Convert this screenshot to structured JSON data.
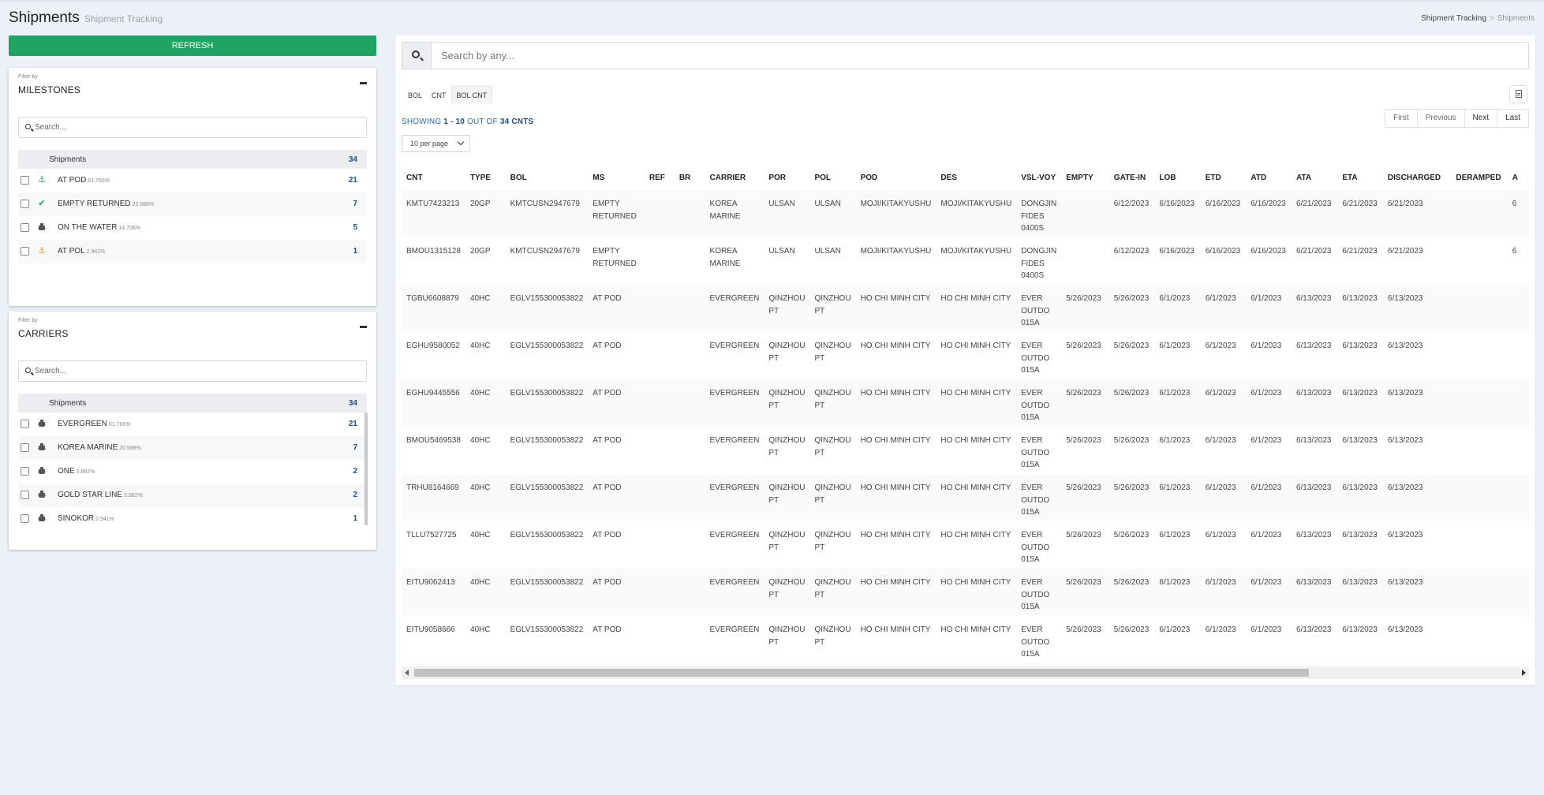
{
  "header": {
    "title": "Shipments",
    "subtitle": "Shipment Tracking"
  },
  "breadcrumb": {
    "parent": "Shipment Tracking",
    "separator": ">",
    "current": "Shipments"
  },
  "refresh_label": "REFRESH",
  "milestones": {
    "filter_by": "Filter by",
    "title": "MILESTONES",
    "search_placeholder": "Search...",
    "header_label": "Shipments",
    "header_count": "34",
    "items": [
      {
        "label": "AT POD",
        "pct": "61.765%",
        "count": "21",
        "icon": "anchor-icon"
      },
      {
        "label": "EMPTY RETURNED",
        "pct": "20.588%",
        "count": "7",
        "icon": "check-icon"
      },
      {
        "label": "ON THE WATER",
        "pct": "14.706%",
        "count": "5",
        "icon": "ship-icon"
      },
      {
        "label": "AT POL",
        "pct": "2.941%",
        "count": "1",
        "icon": "anchor-icon"
      }
    ]
  },
  "carriers": {
    "filter_by": "Filter by",
    "title": "CARRIERS",
    "search_placeholder": "Search...",
    "header_label": "Shipments",
    "header_count": "34",
    "items": [
      {
        "label": "EVERGREEN",
        "pct": "61.765%",
        "count": "21",
        "icon": "ship-icon"
      },
      {
        "label": "KOREA MARINE",
        "pct": "20.588%",
        "count": "7",
        "icon": "ship-icon"
      },
      {
        "label": "ONE",
        "pct": "5.882%",
        "count": "2",
        "icon": "ship-icon"
      },
      {
        "label": "GOLD STAR LINE",
        "pct": "5.882%",
        "count": "2",
        "icon": "ship-icon"
      },
      {
        "label": "SINOKOR",
        "pct": "2.941%",
        "count": "1",
        "icon": "ship-icon"
      }
    ]
  },
  "search": {
    "placeholder": "Search by any..."
  },
  "view_tabs": [
    "BOL",
    "CNT",
    "BOL CNT"
  ],
  "active_view_tab": "BOL CNT",
  "showing": {
    "prefix": "SHOWING",
    "range": "1 - 10",
    "mid": "OUT OF",
    "total": "34 CNTS"
  },
  "pagination": {
    "first": "First",
    "previous": "Previous",
    "next": "Next",
    "last": "Last"
  },
  "per_page": "10 per page",
  "table": {
    "columns": [
      "CNT",
      "TYPE",
      "BOL",
      "MS",
      "REF",
      "BR",
      "CARRIER",
      "POR",
      "POL",
      "POD",
      "DES",
      "VSL-VOY",
      "EMPTY",
      "GATE-IN",
      "LOB",
      "ETD",
      "ATD",
      "ATA",
      "ETA",
      "DISCHARGED",
      "DERAMPED",
      "A"
    ],
    "rows": [
      [
        "KMTU7423213",
        "20GP",
        "KMTCUSN2947679",
        "EMPTY RETURNED",
        "",
        "",
        "KOREA MARINE",
        "ULSAN",
        "ULSAN",
        "MOJI/KITAKYUSHU",
        "MOJI/KITAKYUSHU",
        "DONGJIN FIDES 0400S",
        "",
        "6/12/2023",
        "6/16/2023",
        "6/16/2023",
        "6/16/2023",
        "6/21/2023",
        "6/21/2023",
        "6/21/2023",
        "",
        "6"
      ],
      [
        "BMOU1315128",
        "20GP",
        "KMTCUSN2947679",
        "EMPTY RETURNED",
        "",
        "",
        "KOREA MARINE",
        "ULSAN",
        "ULSAN",
        "MOJI/KITAKYUSHU",
        "MOJI/KITAKYUSHU",
        "DONGJIN FIDES 0400S",
        "",
        "6/12/2023",
        "6/16/2023",
        "6/16/2023",
        "6/16/2023",
        "6/21/2023",
        "6/21/2023",
        "6/21/2023",
        "",
        "6"
      ],
      [
        "TGBU6608879",
        "40HC",
        "EGLV155300053822",
        "AT POD",
        "",
        "",
        "EVERGREEN",
        "QINZHOU PT",
        "QINZHOU PT",
        "HO CHI MINH CITY",
        "HO CHI MINH CITY",
        "EVER OUTDO 015A",
        "5/26/2023",
        "5/26/2023",
        "6/1/2023",
        "6/1/2023",
        "6/1/2023",
        "6/13/2023",
        "6/13/2023",
        "6/13/2023",
        "",
        ""
      ],
      [
        "EGHU9580052",
        "40HC",
        "EGLV155300053822",
        "AT POD",
        "",
        "",
        "EVERGREEN",
        "QINZHOU PT",
        "QINZHOU PT",
        "HO CHI MINH CITY",
        "HO CHI MINH CITY",
        "EVER OUTDO 015A",
        "5/26/2023",
        "5/26/2023",
        "6/1/2023",
        "6/1/2023",
        "6/1/2023",
        "6/13/2023",
        "6/13/2023",
        "6/13/2023",
        "",
        ""
      ],
      [
        "EGHU9445556",
        "40HC",
        "EGLV155300053822",
        "AT POD",
        "",
        "",
        "EVERGREEN",
        "QINZHOU PT",
        "QINZHOU PT",
        "HO CHI MINH CITY",
        "HO CHI MINH CITY",
        "EVER OUTDO 015A",
        "5/26/2023",
        "5/26/2023",
        "6/1/2023",
        "6/1/2023",
        "6/1/2023",
        "6/13/2023",
        "6/13/2023",
        "6/13/2023",
        "",
        ""
      ],
      [
        "BMOU5469538",
        "40HC",
        "EGLV155300053822",
        "AT POD",
        "",
        "",
        "EVERGREEN",
        "QINZHOU PT",
        "QINZHOU PT",
        "HO CHI MINH CITY",
        "HO CHI MINH CITY",
        "EVER OUTDO 015A",
        "5/26/2023",
        "5/26/2023",
        "6/1/2023",
        "6/1/2023",
        "6/1/2023",
        "6/13/2023",
        "6/13/2023",
        "6/13/2023",
        "",
        ""
      ],
      [
        "TRHU8164669",
        "40HC",
        "EGLV155300053822",
        "AT POD",
        "",
        "",
        "EVERGREEN",
        "QINZHOU PT",
        "QINZHOU PT",
        "HO CHI MINH CITY",
        "HO CHI MINH CITY",
        "EVER OUTDO 015A",
        "5/26/2023",
        "5/26/2023",
        "6/1/2023",
        "6/1/2023",
        "6/1/2023",
        "6/13/2023",
        "6/13/2023",
        "6/13/2023",
        "",
        ""
      ],
      [
        "TLLU7527725",
        "40HC",
        "EGLV155300053822",
        "AT POD",
        "",
        "",
        "EVERGREEN",
        "QINZHOU PT",
        "QINZHOU PT",
        "HO CHI MINH CITY",
        "HO CHI MINH CITY",
        "EVER OUTDO 015A",
        "5/26/2023",
        "5/26/2023",
        "6/1/2023",
        "6/1/2023",
        "6/1/2023",
        "6/13/2023",
        "6/13/2023",
        "6/13/2023",
        "",
        ""
      ],
      [
        "EITU9062413",
        "40HC",
        "EGLV155300053822",
        "AT POD",
        "",
        "",
        "EVERGREEN",
        "QINZHOU PT",
        "QINZHOU PT",
        "HO CHI MINH CITY",
        "HO CHI MINH CITY",
        "EVER OUTDO 015A",
        "5/26/2023",
        "5/26/2023",
        "6/1/2023",
        "6/1/2023",
        "6/1/2023",
        "6/13/2023",
        "6/13/2023",
        "6/13/2023",
        "",
        ""
      ],
      [
        "EITU9058666",
        "40HC",
        "EGLV155300053822",
        "AT POD",
        "",
        "",
        "EVERGREEN",
        "QINZHOU PT",
        "QINZHOU PT",
        "HO CHI MINH CITY",
        "HO CHI MINH CITY",
        "EVER OUTDO 015A",
        "5/26/2023",
        "5/26/2023",
        "6/1/2023",
        "6/1/2023",
        "6/1/2023",
        "6/13/2023",
        "6/13/2023",
        "6/13/2023",
        "",
        ""
      ]
    ]
  },
  "colors": {
    "accent_green": "#1fa463",
    "count_blue": "#1e4e8c",
    "anchor_orange": "#f0952a",
    "background": "#edf1f7"
  }
}
